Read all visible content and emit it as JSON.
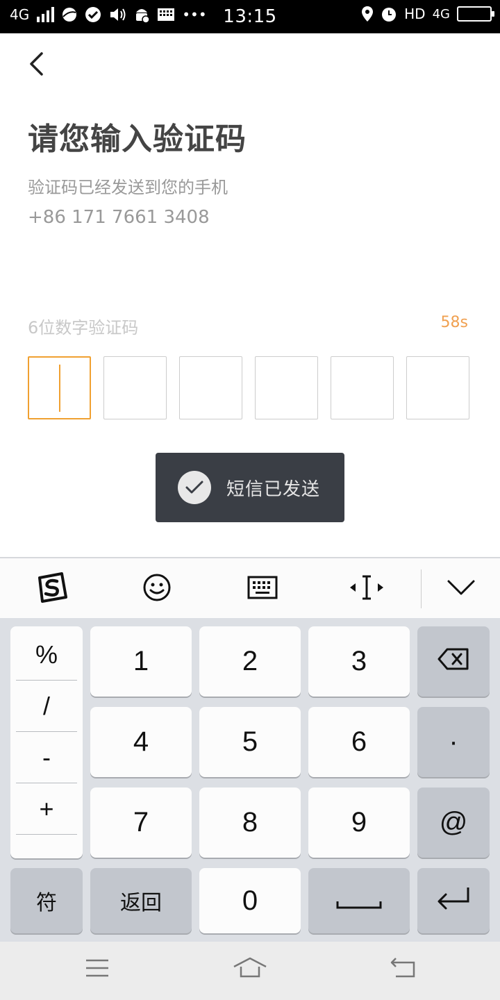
{
  "status_bar": {
    "network": "4G",
    "time": "13:15",
    "hd_label": "HD",
    "network_right": "4G",
    "more": "•••"
  },
  "header": {
    "title": "请您输入验证码",
    "description": "验证码已经发送到您的手机",
    "phone": "+86 171 7661 3408"
  },
  "code_input": {
    "label": "6位数字验证码",
    "countdown": "58s",
    "digits": [
      "",
      "",
      "",
      "",
      "",
      ""
    ]
  },
  "toast": {
    "text": "短信已发送"
  },
  "keyboard": {
    "symbols": [
      "%",
      "/",
      "-",
      "+"
    ],
    "keys": {
      "k1": "1",
      "k2": "2",
      "k3": "3",
      "k4": "4",
      "k5": "5",
      "k6": "6",
      "k7": "7",
      "k8": "8",
      "k9": "9",
      "k0": "0",
      "dot": "·",
      "at": "@",
      "symbol": "符",
      "back": "返回"
    }
  },
  "colors": {
    "accent": "#f0a030",
    "toast_bg": "#3a3e45",
    "keyboard_bg": "#dcdfe4"
  }
}
